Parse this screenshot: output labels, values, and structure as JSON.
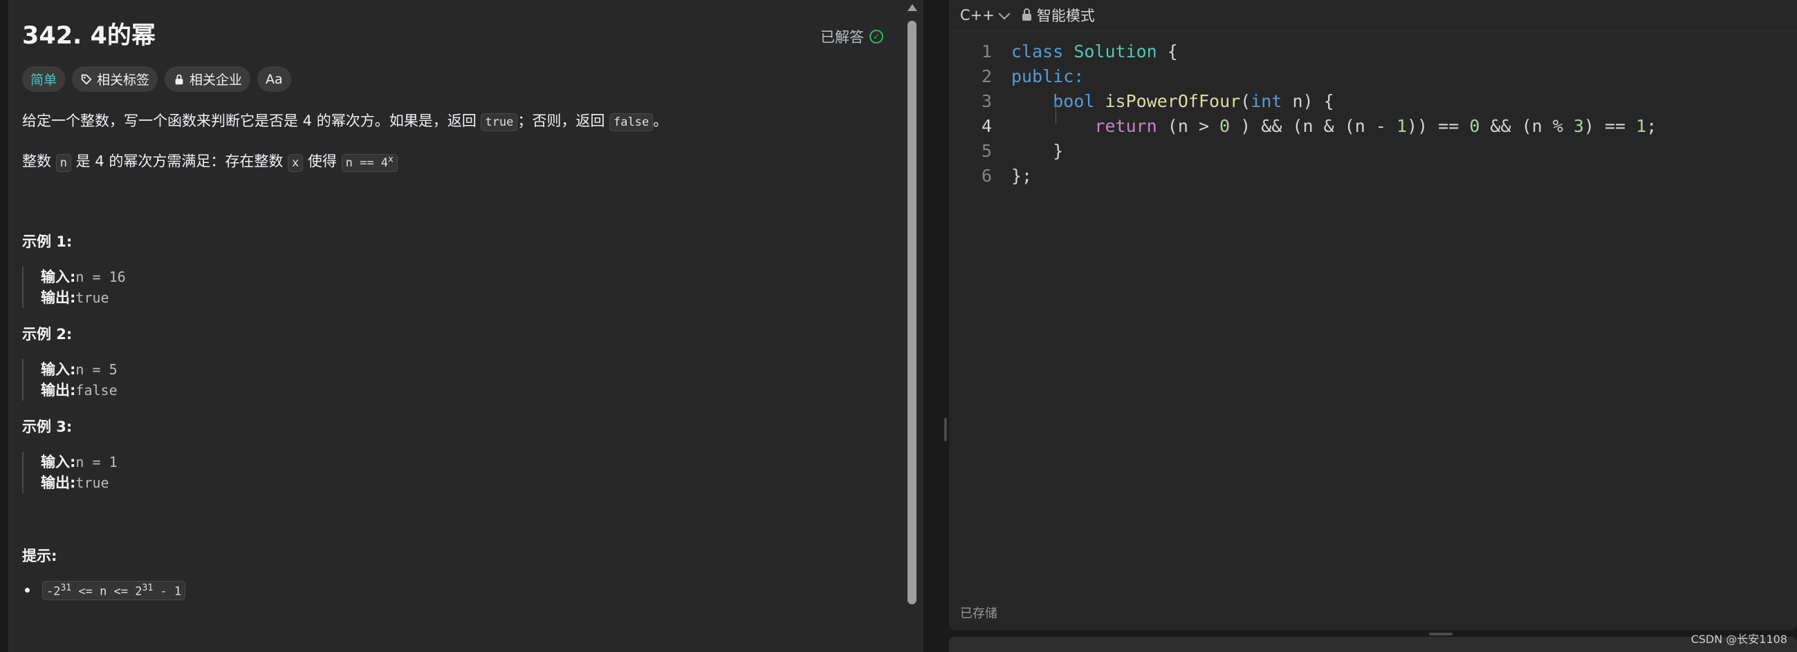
{
  "problem": {
    "title": "342. 4的幂",
    "status": "已解答",
    "tags": [
      "简单",
      "相关标签",
      "相关企业",
      "Aa"
    ],
    "desc1_a": "给定一个整数，写一个函数来判断它是否是 4 的幂次方。如果是，返回 ",
    "desc1_true": "true",
    "desc1_b": "；否则，返回 ",
    "desc1_false": "false",
    "desc1_c": "。",
    "desc2_a": "整数 ",
    "desc2_n": "n",
    "desc2_b": " 是 4 的幂次方需满足：存在整数 ",
    "desc2_x": "x",
    "desc2_c": " 使得 ",
    "desc2_expr": "n == 4",
    "desc2_sup": "x",
    "examples": [
      {
        "title": "示例 1:",
        "input_label": "输入:",
        "input": "n = 16",
        "output_label": "输出:",
        "output": "true"
      },
      {
        "title": "示例 2:",
        "input_label": "输入:",
        "input": "n = 5",
        "output_label": "输出:",
        "output": "false"
      },
      {
        "title": "示例 3:",
        "input_label": "输入:",
        "input": "n = 1",
        "output_label": "输出:",
        "output": "true"
      }
    ],
    "hint_title": "提示:",
    "hint_a": "-2",
    "hint_sup1": "31",
    "hint_b": " <= n <= 2",
    "hint_sup2": "31",
    "hint_c": " - 1"
  },
  "editor": {
    "language": "C++",
    "mode": "智能模式",
    "saved": "已存储",
    "line_numbers": [
      "1",
      "2",
      "3",
      "4",
      "5",
      "6"
    ],
    "active_line": 4,
    "l1_kw": "class",
    "l1_ty": "Solution",
    "l1_rest": " {",
    "l2": "public:",
    "l3_kw": "bool",
    "l3_fn": "isPowerOfFour",
    "l3_p1": "(",
    "l3_int": "int",
    "l3_p2": " n) {",
    "l4_ret": "return",
    "l4_a": " (n > ",
    "l4_n0": "0",
    "l4_b": " ) && (n & (n - ",
    "l4_n1": "1",
    "l4_c": ")) == ",
    "l4_n2": "0",
    "l4_d": " && (n % ",
    "l4_n3": "3",
    "l4_e": ") == ",
    "l4_n4": "1",
    "l4_f": ";",
    "l5": "}",
    "l6": "};"
  },
  "watermark": "CSDN @长安1108"
}
